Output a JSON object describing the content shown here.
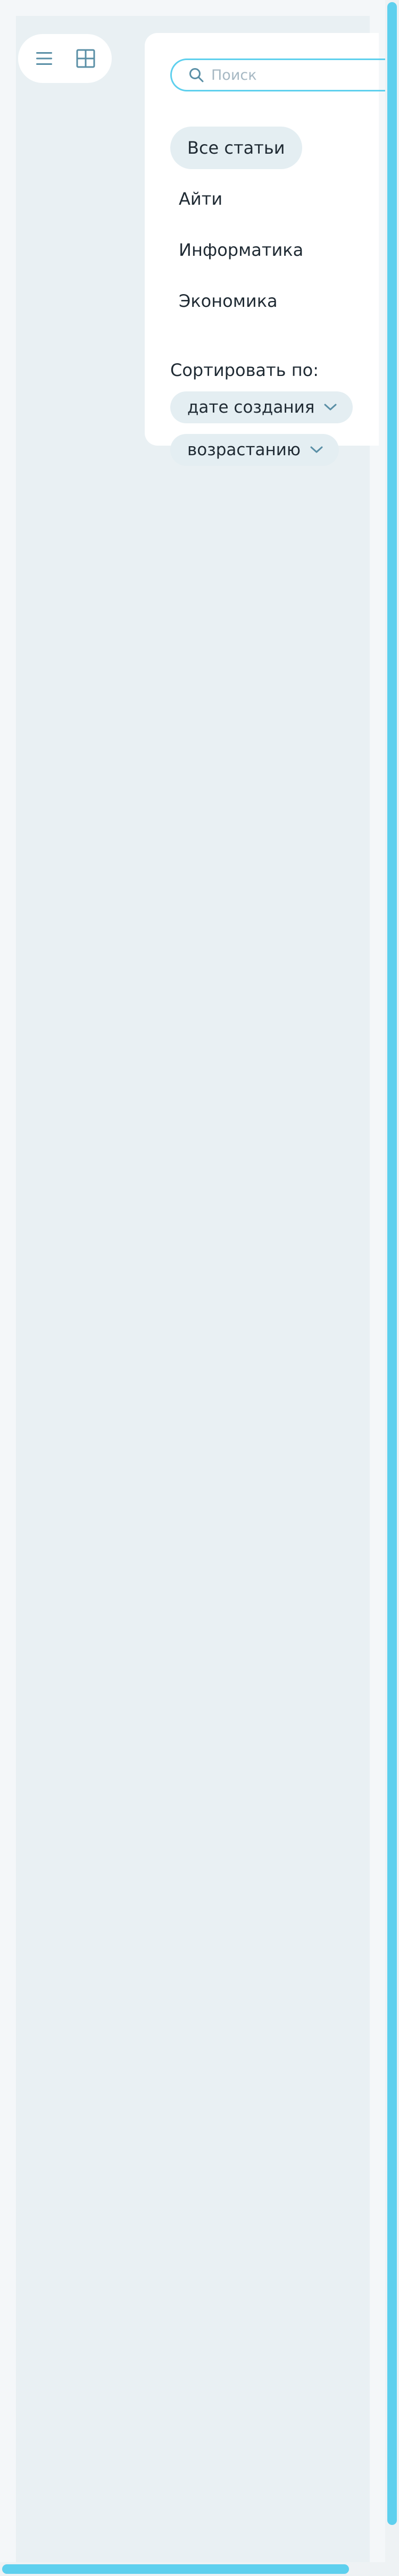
{
  "search": {
    "placeholder": "Поиск",
    "value": ""
  },
  "view_toggle": {
    "list_icon": "menu-icon",
    "grid_icon": "grid-icon"
  },
  "categories": [
    {
      "label": "Все статьи",
      "active": true
    },
    {
      "label": "Айти",
      "active": false
    },
    {
      "label": "Информатика",
      "active": false
    },
    {
      "label": "Экономика",
      "active": false
    }
  ],
  "sort": {
    "label": "Сортировать по:",
    "field": "дате создания",
    "order": "возрастанию"
  },
  "colors": {
    "accent": "#5ed0ee",
    "icon": "#5a8fa6",
    "pill_bg": "#e4eef2",
    "page_bg": "#e9f0f3",
    "text": "#1f2a33"
  }
}
